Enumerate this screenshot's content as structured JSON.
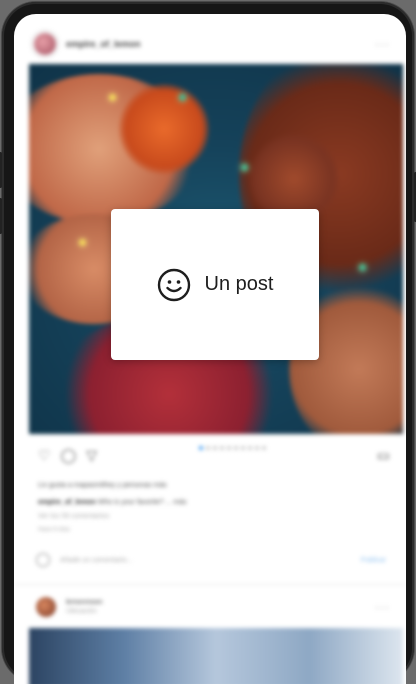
{
  "post": {
    "username": "empire_of_lemon",
    "more_icon": "ellipsis-icon",
    "image_subject": "illustration",
    "actions": [
      "heart-icon",
      "comment-icon",
      "send-icon",
      "bookmark-icon"
    ],
    "likes_line": "Liv gusta a mapasmithey y personas más",
    "caption_user": "empire_of_lemon",
    "caption_text": "Who is your favorite? ... más",
    "view_comments": "Ver los 59 comentarios",
    "time_ago": "Hace 6 días",
    "comment_placeholder": "Añade un comentario...",
    "publish_label": "Publicar"
  },
  "second_post": {
    "username": "lemonmoon",
    "subtitle": "Ubicación"
  },
  "overlay": {
    "icon": "smiley-icon",
    "label": "Un post"
  },
  "colors": {
    "accent": "#3897f0",
    "overlay_bg": "#ffffff",
    "frame": "#161616"
  }
}
